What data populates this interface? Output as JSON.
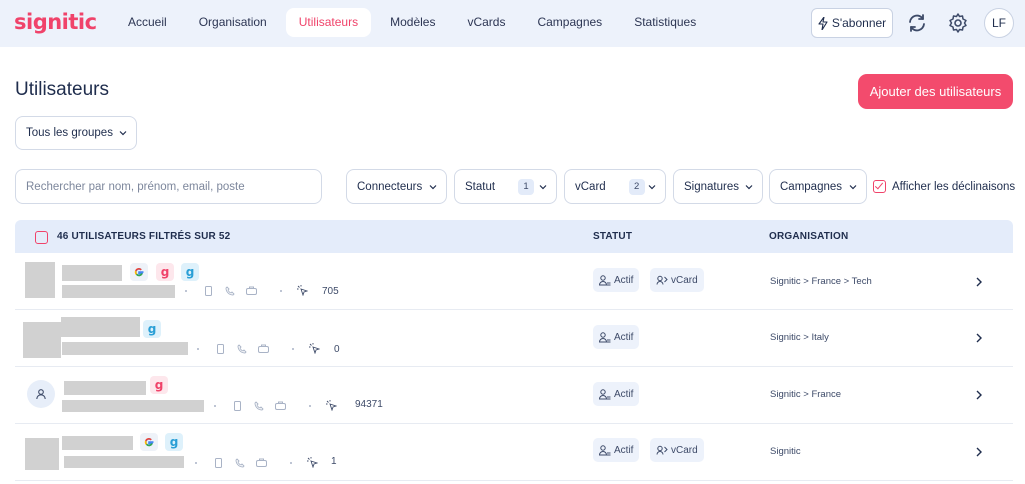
{
  "brand": {
    "logo": "signitic",
    "accent": "#f0436a"
  },
  "nav": {
    "items": [
      {
        "label": "Accueil"
      },
      {
        "label": "Organisation"
      },
      {
        "label": "Utilisateurs",
        "active": true
      },
      {
        "label": "Modèles"
      },
      {
        "label": "vCards"
      },
      {
        "label": "Campagnes"
      },
      {
        "label": "Statistiques"
      }
    ],
    "subscribe": "S'abonner",
    "avatar": "LF"
  },
  "page": {
    "title": "Utilisateurs",
    "add_button": "Ajouter des utilisateurs",
    "group_filter": "Tous les groupes"
  },
  "filters": {
    "search_placeholder": "Rechercher par nom, prénom, email, poste",
    "connecteurs": "Connecteurs",
    "statut": "Statut",
    "statut_count": "1",
    "vcard": "vCard",
    "vcard_count": "2",
    "signatures": "Signatures",
    "campagnes": "Campagnes",
    "declinaisons": "Afficher les déclinaisons"
  },
  "table": {
    "count_label": "46 UTILISATEURS FILTRÉS SUR 52",
    "col_statut": "STATUT",
    "col_org": "ORGANISATION",
    "rows": [
      {
        "badges": [
          "google",
          "gmail",
          "outlook"
        ],
        "stat": "705",
        "status": "Actif",
        "vcard": "vCard",
        "org": "Signitic > France > Tech"
      },
      {
        "badges": [
          "outlook"
        ],
        "stat": "0",
        "status": "Actif",
        "org": "Signitic > Italy"
      },
      {
        "badges": [
          "gmail"
        ],
        "stat": "94371",
        "status": "Actif",
        "org": "Signitic > France"
      },
      {
        "badges": [
          "google",
          "outlook"
        ],
        "stat": "1",
        "status": "Actif",
        "vcard": "vCard",
        "org": "Signitic"
      }
    ]
  }
}
